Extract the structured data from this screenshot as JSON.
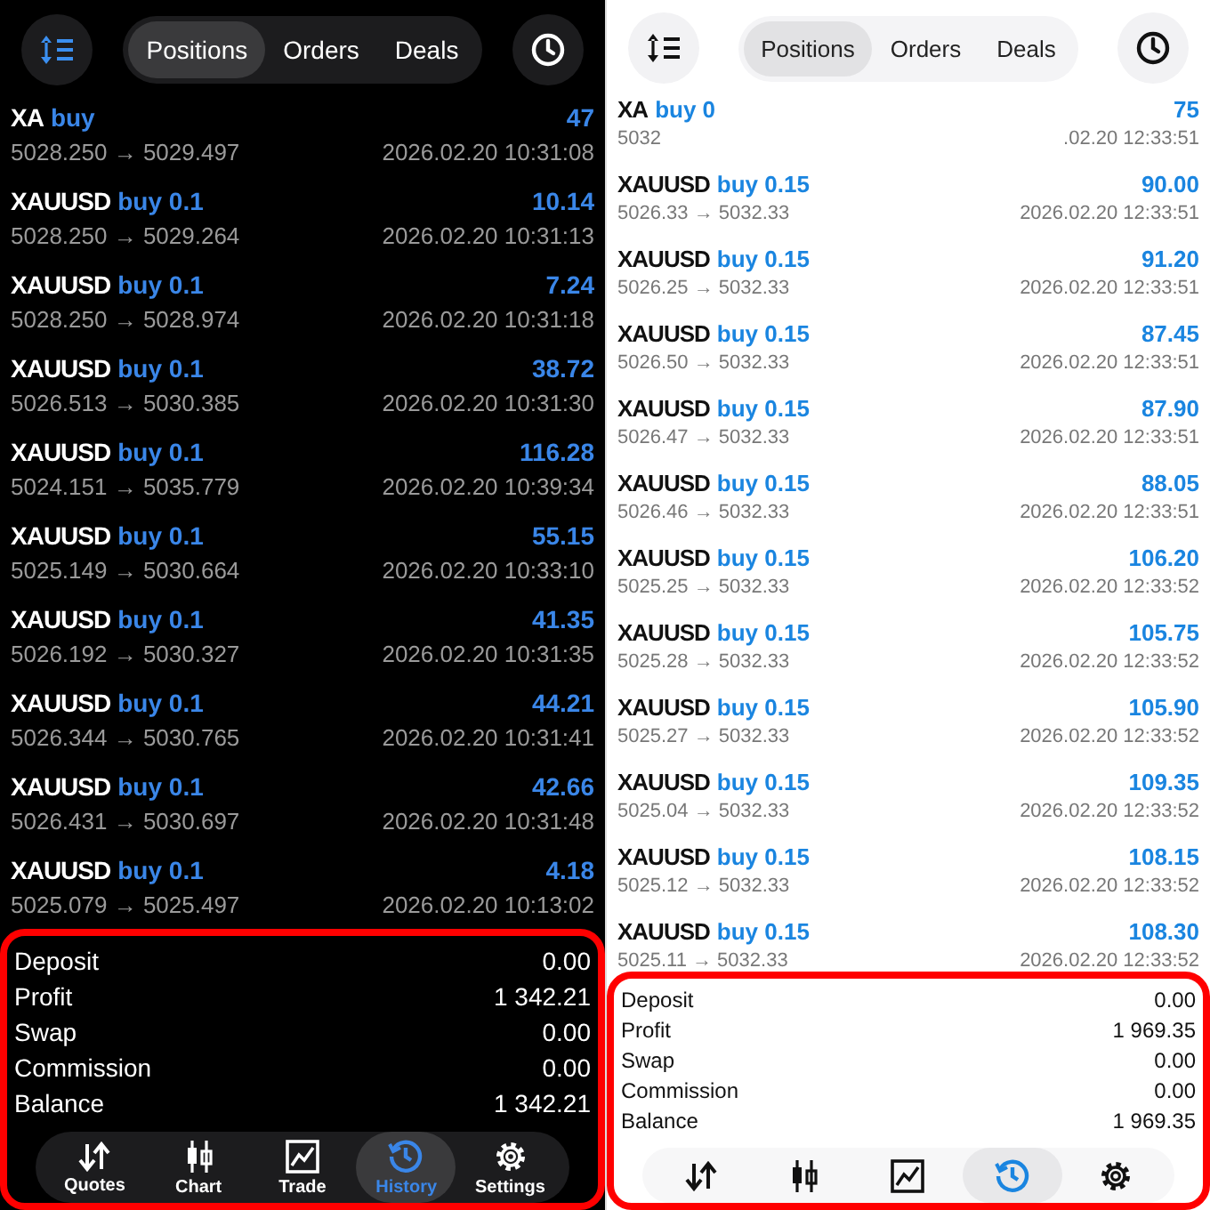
{
  "panels": [
    {
      "kind": "dark",
      "tabs": [
        {
          "label": "Positions",
          "selected": true
        },
        {
          "label": "Orders",
          "selected": false
        },
        {
          "label": "Deals",
          "selected": false
        }
      ],
      "deals": [
        {
          "symbol": "XA",
          "side": "buy",
          "profit": "47",
          "prices": "5028.250 → 5029.497",
          "time": "2026.02.20 10:31:08"
        },
        {
          "symbol": "XAUUSD",
          "side": "buy 0.1",
          "profit": "10.14",
          "prices": "5028.250 → 5029.264",
          "time": "2026.02.20 10:31:13"
        },
        {
          "symbol": "XAUUSD",
          "side": "buy 0.1",
          "profit": "7.24",
          "prices": "5028.250 → 5028.974",
          "time": "2026.02.20 10:31:18"
        },
        {
          "symbol": "XAUUSD",
          "side": "buy 0.1",
          "profit": "38.72",
          "prices": "5026.513 → 5030.385",
          "time": "2026.02.20 10:31:30"
        },
        {
          "symbol": "XAUUSD",
          "side": "buy 0.1",
          "profit": "116.28",
          "prices": "5024.151 → 5035.779",
          "time": "2026.02.20 10:39:34"
        },
        {
          "symbol": "XAUUSD",
          "side": "buy 0.1",
          "profit": "55.15",
          "prices": "5025.149 → 5030.664",
          "time": "2026.02.20 10:33:10"
        },
        {
          "symbol": "XAUUSD",
          "side": "buy 0.1",
          "profit": "41.35",
          "prices": "5026.192 → 5030.327",
          "time": "2026.02.20 10:31:35"
        },
        {
          "symbol": "XAUUSD",
          "side": "buy 0.1",
          "profit": "44.21",
          "prices": "5026.344 → 5030.765",
          "time": "2026.02.20 10:31:41"
        },
        {
          "symbol": "XAUUSD",
          "side": "buy 0.1",
          "profit": "42.66",
          "prices": "5026.431 → 5030.697",
          "time": "2026.02.20 10:31:48"
        },
        {
          "symbol": "XAUUSD",
          "side": "buy 0.1",
          "profit": "4.18",
          "prices": "5025.079 → 5025.497",
          "time": "2026.02.20 10:13:02"
        }
      ],
      "summary": [
        {
          "label": "Deposit",
          "value": "0.00"
        },
        {
          "label": "Profit",
          "value": "1 342.21"
        },
        {
          "label": "Swap",
          "value": "0.00"
        },
        {
          "label": "Commission",
          "value": "0.00"
        },
        {
          "label": "Balance",
          "value": "1 342.21"
        }
      ],
      "nav": [
        {
          "kind": "quotes",
          "label": "Quotes",
          "selected": false
        },
        {
          "kind": "chart",
          "label": "Chart",
          "selected": false
        },
        {
          "kind": "trade",
          "label": "Trade",
          "selected": false
        },
        {
          "kind": "history",
          "label": "History",
          "selected": true
        },
        {
          "kind": "settings",
          "label": "Settings",
          "selected": false
        }
      ]
    },
    {
      "kind": "light",
      "tabs": [
        {
          "label": "Positions",
          "selected": true
        },
        {
          "label": "Orders",
          "selected": false
        },
        {
          "label": "Deals",
          "selected": false
        }
      ],
      "deals": [
        {
          "symbol": "XA",
          "side": "buy 0",
          "profit": "75",
          "prices": "5032",
          "time": ".02.20 12:33:51"
        },
        {
          "symbol": "XAUUSD",
          "side": "buy 0.15",
          "profit": "90.00",
          "prices": "5026.33 → 5032.33",
          "time": "2026.02.20 12:33:51"
        },
        {
          "symbol": "XAUUSD",
          "side": "buy 0.15",
          "profit": "91.20",
          "prices": "5026.25 → 5032.33",
          "time": "2026.02.20 12:33:51"
        },
        {
          "symbol": "XAUUSD",
          "side": "buy 0.15",
          "profit": "87.45",
          "prices": "5026.50 → 5032.33",
          "time": "2026.02.20 12:33:51"
        },
        {
          "symbol": "XAUUSD",
          "side": "buy 0.15",
          "profit": "87.90",
          "prices": "5026.47 → 5032.33",
          "time": "2026.02.20 12:33:51"
        },
        {
          "symbol": "XAUUSD",
          "side": "buy 0.15",
          "profit": "88.05",
          "prices": "5026.46 → 5032.33",
          "time": "2026.02.20 12:33:51"
        },
        {
          "symbol": "XAUUSD",
          "side": "buy 0.15",
          "profit": "106.20",
          "prices": "5025.25 → 5032.33",
          "time": "2026.02.20 12:33:52"
        },
        {
          "symbol": "XAUUSD",
          "side": "buy 0.15",
          "profit": "105.75",
          "prices": "5025.28 → 5032.33",
          "time": "2026.02.20 12:33:52"
        },
        {
          "symbol": "XAUUSD",
          "side": "buy 0.15",
          "profit": "105.90",
          "prices": "5025.27 → 5032.33",
          "time": "2026.02.20 12:33:52"
        },
        {
          "symbol": "XAUUSD",
          "side": "buy 0.15",
          "profit": "109.35",
          "prices": "5025.04 → 5032.33",
          "time": "2026.02.20 12:33:52"
        },
        {
          "symbol": "XAUUSD",
          "side": "buy 0.15",
          "profit": "108.15",
          "prices": "5025.12 → 5032.33",
          "time": "2026.02.20 12:33:52"
        },
        {
          "symbol": "XAUUSD",
          "side": "buy 0.15",
          "profit": "108.30",
          "prices": "5025.11 → 5032.33",
          "time": "2026.02.20 12:33:52"
        }
      ],
      "summary": [
        {
          "label": "Deposit",
          "value": "0.00"
        },
        {
          "label": "Profit",
          "value": "1 969.35"
        },
        {
          "label": "Swap",
          "value": "0.00"
        },
        {
          "label": "Commission",
          "value": "0.00"
        },
        {
          "label": "Balance",
          "value": "1 969.35"
        }
      ],
      "nav": [
        {
          "kind": "quotes",
          "selected": false
        },
        {
          "kind": "chart",
          "selected": false
        },
        {
          "kind": "trade",
          "selected": false
        },
        {
          "kind": "history",
          "selected": true
        },
        {
          "kind": "settings",
          "selected": false
        }
      ]
    }
  ]
}
